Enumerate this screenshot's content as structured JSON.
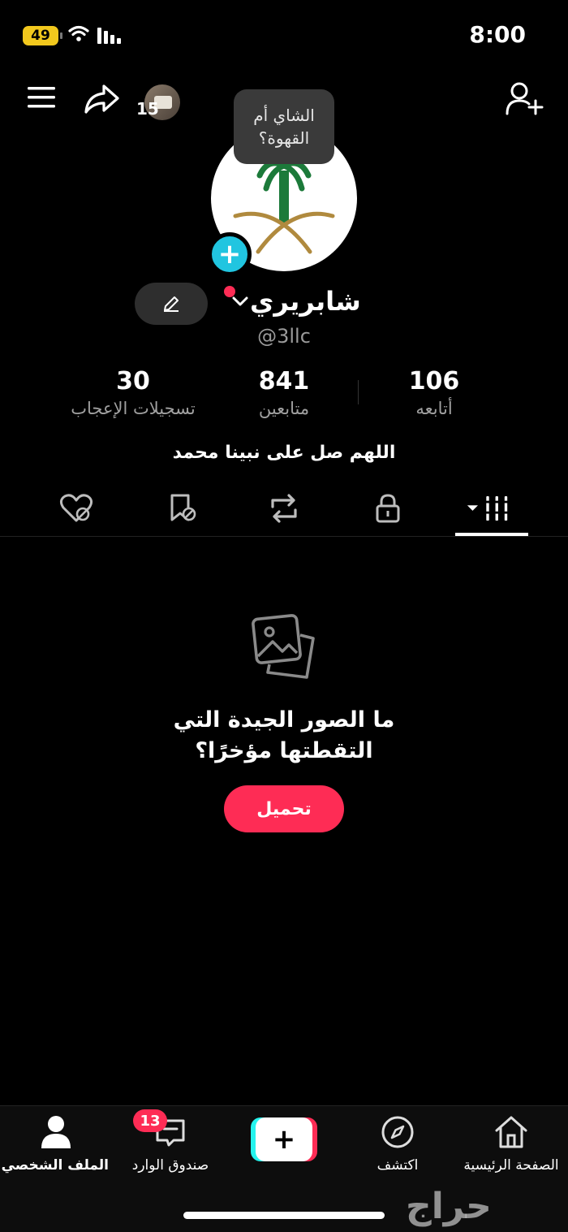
{
  "status_bar": {
    "battery": "49",
    "time": "8:00"
  },
  "header": {
    "avatar_count": "15"
  },
  "tooltip": {
    "line1": "الشاي أم",
    "line2": "القهوة؟"
  },
  "profile": {
    "display_name": "شابريري",
    "username": "@3llc"
  },
  "stats": {
    "likes": {
      "value": "30",
      "label": "تسجيلات الإعجاب"
    },
    "followers": {
      "value": "841",
      "label": "متابعين"
    },
    "following": {
      "value": "106",
      "label": "أتابعه"
    }
  },
  "bio": "اللهم صل على نبينا محمد",
  "tabs": [
    "grid-icon",
    "lock-icon",
    "repost-icon",
    "bookmark-icon",
    "liked-icon"
  ],
  "empty_state": {
    "line1": "ما الصور الجيدة التي",
    "line2": "التقطتها مؤخرًا؟",
    "button": "تحميل"
  },
  "bottom_nav": {
    "profile": "الملف الشخصي",
    "inbox": "صندوق الوارد",
    "inbox_badge": "13",
    "create": "+",
    "discover": "اكتشف",
    "home": "الصفحة الرئيسية"
  },
  "watermark": "حراج",
  "colors": {
    "accent": "#fe2c55",
    "cyan": "#25f4ee",
    "background": "#000000"
  }
}
